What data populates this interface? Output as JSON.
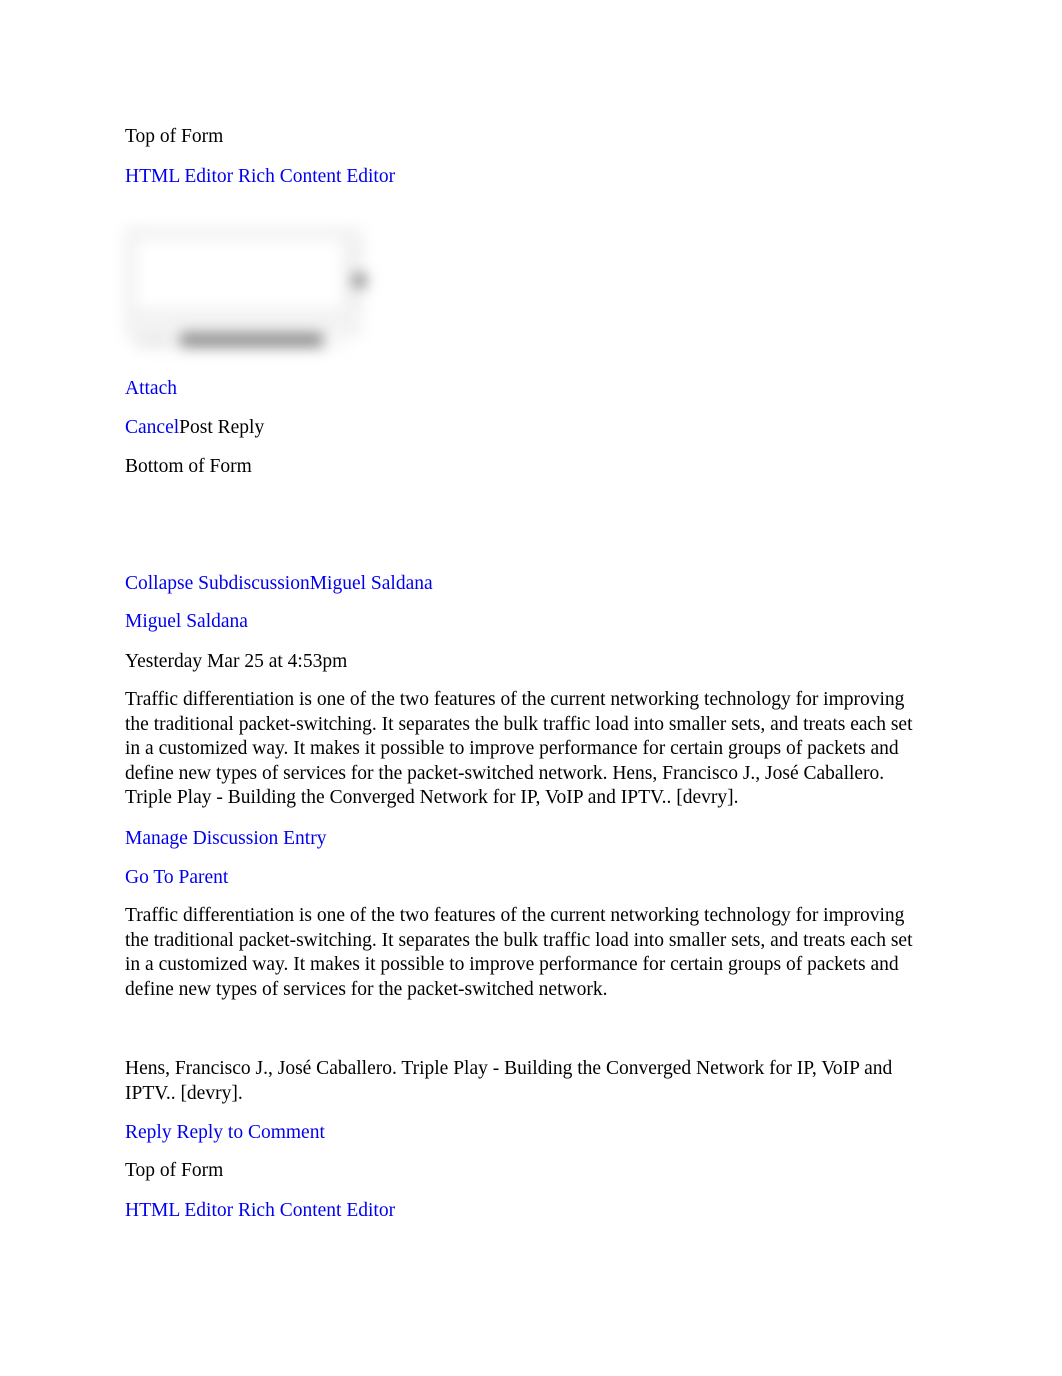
{
  "document": {
    "type": "discussion-thread-export",
    "link_color": "#0000ee",
    "text_color": "#000000",
    "background": "#ffffff"
  },
  "reply_form_top": {
    "top_of_form": "Top of Form",
    "editor_toggle": "HTML Editor Rich Content Editor",
    "editor_image_alt": "blurred screenshot of rich content editor text area with scrollbar and status bar",
    "attach": "Attach",
    "cancel": "Cancel",
    "post_reply": "Post Reply",
    "bottom_of_form": "Bottom of Form"
  },
  "thread": {
    "collapse_subdiscussion": "Collapse Subdiscussion",
    "collapse_author": "Miguel Saldana",
    "author": "Miguel Saldana",
    "timestamp": "Yesterday Mar 25 at 4:53pm",
    "body": "Traffic differentiation is one of the two features of the current networking technology for improving the traditional packet-switching. It separates the bulk traffic load into smaller sets, and treats each set in a customized way. It makes it possible to improve performance for certain groups of packets and define new types of services for the packet-switched network. Hens, Francisco J., José Caballero. Triple Play - Building the Converged Network for IP, VoIP and IPTV.. [devry].",
    "manage_discussion_entry": "Manage Discussion Entry",
    "go_to_parent": "Go To Parent",
    "quoted_body": "Traffic differentiation is one of the two features of the current networking technology for improving the traditional packet-switching. It separates the bulk traffic load into smaller sets, and treats each set in a customized way. It makes it possible to improve performance for certain groups of packets and define new types of services for the packet-switched network.",
    "citation": "Hens, Francisco J., José Caballero. Triple Play - Building the Converged Network for IP, VoIP and IPTV.. [devry].",
    "reply": "Reply",
    "reply_to_comment": "Reply to Comment"
  },
  "reply_form_bottom": {
    "top_of_form": "Top of Form",
    "editor_toggle": "HTML Editor Rich Content Editor"
  }
}
